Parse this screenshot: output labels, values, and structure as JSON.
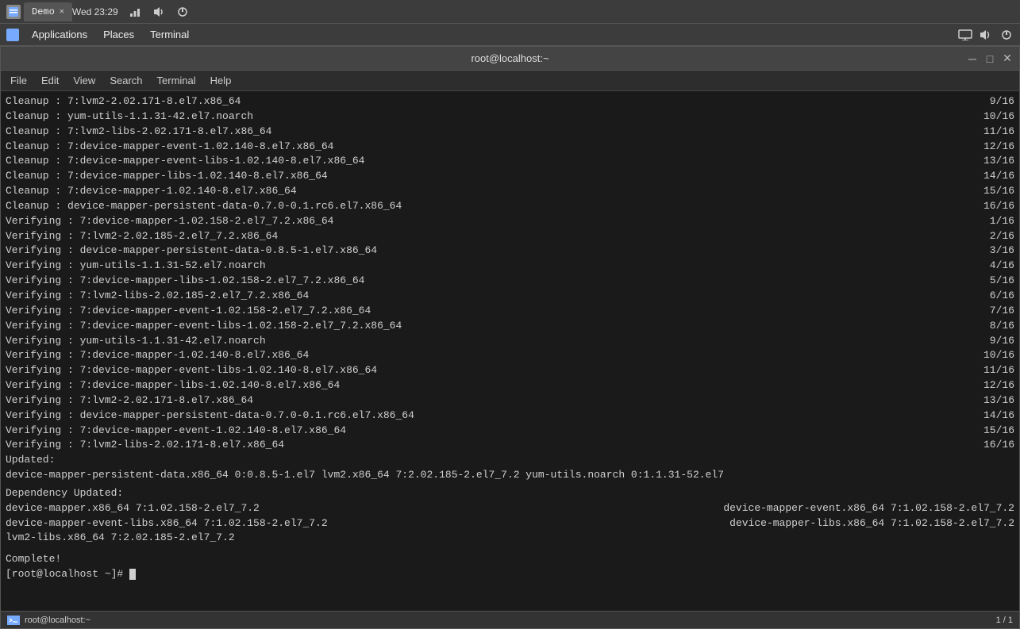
{
  "taskbar": {
    "tab_label": "Demo",
    "time": "Wed 23:29"
  },
  "top_panel": {
    "applications": "Applications",
    "places": "Places",
    "terminal": "Terminal"
  },
  "terminal_title": "root@localhost:~",
  "terminal_menu": {
    "file": "File",
    "edit": "Edit",
    "view": "View",
    "search": "Search",
    "terminal": "Terminal",
    "help": "Help"
  },
  "cleanup_lines": [
    {
      "left": "Cleanup    : 7:lvm2-2.02.171-8.el7.x86_64",
      "right": "9/16"
    },
    {
      "left": "Cleanup    : yum-utils-1.1.31-42.el7.noarch",
      "right": "10/16"
    },
    {
      "left": "Cleanup    : 7:lvm2-libs-2.02.171-8.el7.x86_64",
      "right": "11/16"
    },
    {
      "left": "Cleanup    : 7:device-mapper-event-1.02.140-8.el7.x86_64",
      "right": "12/16"
    },
    {
      "left": "Cleanup    : 7:device-mapper-event-libs-1.02.140-8.el7.x86_64",
      "right": "13/16"
    },
    {
      "left": "Cleanup    : 7:device-mapper-libs-1.02.140-8.el7.x86_64",
      "right": "14/16"
    },
    {
      "left": "Cleanup    : 7:device-mapper-1.02.140-8.el7.x86_64",
      "right": "15/16"
    },
    {
      "left": "Cleanup    : device-mapper-persistent-data-0.7.0-0.1.rc6.el7.x86_64",
      "right": "16/16"
    }
  ],
  "verifying_lines": [
    {
      "left": "Verifying  : 7:device-mapper-1.02.158-2.el7_7.2.x86_64",
      "right": "1/16"
    },
    {
      "left": "Verifying  : 7:lvm2-2.02.185-2.el7_7.2.x86_64",
      "right": "2/16"
    },
    {
      "left": "Verifying  : device-mapper-persistent-data-0.8.5-1.el7.x86_64",
      "right": "3/16"
    },
    {
      "left": "Verifying  : yum-utils-1.1.31-52.el7.noarch",
      "right": "4/16"
    },
    {
      "left": "Verifying  : 7:device-mapper-libs-1.02.158-2.el7_7.2.x86_64",
      "right": "5/16"
    },
    {
      "left": "Verifying  : 7:lvm2-libs-2.02.185-2.el7_7.2.x86_64",
      "right": "6/16"
    },
    {
      "left": "Verifying  : 7:device-mapper-event-1.02.158-2.el7_7.2.x86_64",
      "right": "7/16"
    },
    {
      "left": "Verifying  : 7:device-mapper-event-libs-1.02.158-2.el7_7.2.x86_64",
      "right": "8/16"
    },
    {
      "left": "Verifying  : yum-utils-1.1.31-42.el7.noarch",
      "right": "9/16"
    },
    {
      "left": "Verifying  : 7:device-mapper-1.02.140-8.el7.x86_64",
      "right": "10/16"
    },
    {
      "left": "Verifying  : 7:device-mapper-event-libs-1.02.140-8.el7.x86_64",
      "right": "11/16"
    },
    {
      "left": "Verifying  : 7:device-mapper-libs-1.02.140-8.el7.x86_64",
      "right": "12/16"
    },
    {
      "left": "Verifying  : 7:lvm2-2.02.171-8.el7.x86_64",
      "right": "13/16"
    },
    {
      "left": "Verifying  : device-mapper-persistent-data-0.7.0-0.1.rc6.el7.x86_64",
      "right": "14/16"
    },
    {
      "left": "Verifying  : 7:device-mapper-event-1.02.140-8.el7.x86_64",
      "right": "15/16"
    },
    {
      "left": "Verifying  : 7:lvm2-libs-2.02.171-8.el7.x86_64",
      "right": "16/16"
    }
  ],
  "updated_section": {
    "header": "Updated:",
    "line": "  device-mapper-persistent-data.x86_64 0:0.8.5-1.el7        lvm2.x86_64 7:2.02.185-2.el7_7.2        yum-utils.noarch 0:1.1.31-52.el7"
  },
  "dependency_section": {
    "header": "Dependency Updated:",
    "line1_left": "  device-mapper.x86_64 7:1.02.158-2.el7_7.2",
    "line1_right": "device-mapper-event.x86_64 7:1.02.158-2.el7_7.2",
    "line2_left": "  device-mapper-event-libs.x86_64 7:1.02.158-2.el7_7.2",
    "line2_right": "device-mapper-libs.x86_64 7:1.02.158-2.el7_7.2",
    "line3": "  lvm2-libs.x86_64 7:2.02.185-2.el7_7.2"
  },
  "complete_text": "Complete!",
  "prompt": "[root@localhost ~]# ",
  "bottom_tab": "root@localhost:~",
  "bottom_page": "1 / 1"
}
